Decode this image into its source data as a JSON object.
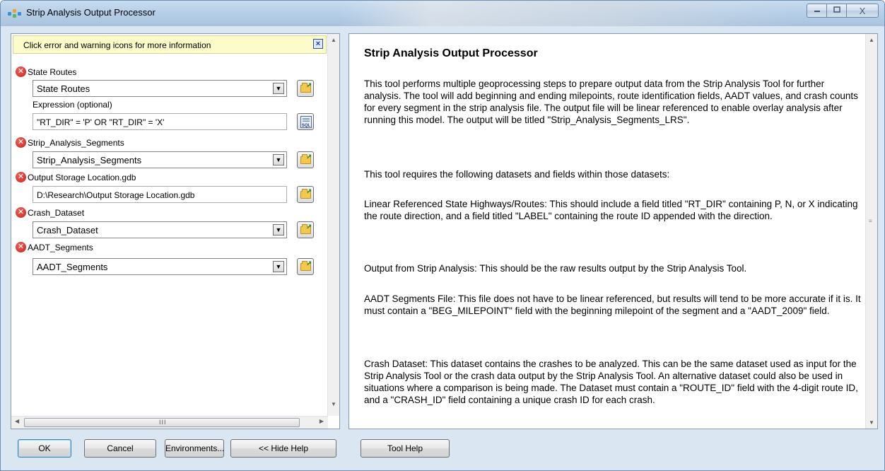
{
  "window": {
    "title": "Strip Analysis Output Processor",
    "controls": {
      "minimize": "▭",
      "maximize": "▢",
      "close": "X"
    }
  },
  "info_bar": {
    "message": "Click error and warning icons for more information",
    "close": "×"
  },
  "parameters": [
    {
      "label": "State Routes",
      "value": "State Routes",
      "control": "combo",
      "error": true
    },
    {
      "label": "Expression (optional)",
      "value": "\"RT_DIR\" = 'P' OR \"RT_DIR\" = 'X'",
      "control": "text-sql",
      "error": false
    },
    {
      "label": "Strip_Analysis_Segments",
      "value": "Strip_Analysis_Segments",
      "control": "combo",
      "error": true
    },
    {
      "label": "Output Storage Location.gdb",
      "value": "D:\\Research\\Output Storage Location.gdb",
      "control": "text",
      "error": true
    },
    {
      "label": "Crash_Dataset",
      "value": "Crash_Dataset",
      "control": "combo",
      "error": true
    },
    {
      "label": "AADT_Segments",
      "value": "AADT_Segments",
      "control": "combo",
      "error": true
    }
  ],
  "help": {
    "title": "Strip Analysis Output Processor",
    "paragraphs": [
      "This tool performs multiple geoprocessing steps to prepare output data from the Strip Analysis Tool for further analysis. The tool will add beginning and ending milepoints, route identification fields, AADT values, and crash counts for every segment in the strip analysis file. The output file will be linear referenced to enable overlay analysis after running this model. The output will be titled \"Strip_Analysis_Segments_LRS\".",
      "This tool requires the following datasets and fields within those datasets:",
      "Linear Referenced State Highways/Routes: This should include a field titled \"RT_DIR\" containing P, N, or X indicating the route direction, and a field titled \"LABEL\" containing the route ID appended with the direction.",
      "Output from Strip Analysis: This should be the raw results output by the Strip Analysis Tool.",
      "AADT Segments File: This file does not have to be linear referenced, but results will tend to be more accurate if it is. It must contain a \"BEG_MILEPOINT\" field with the beginning milepoint of the segment and a \"AADT_2009\" field.",
      "Crash Dataset: This dataset contains the crashes to be analyzed. This can be the same dataset used as input for the Strip Analysis Tool or the crash data output by the Strip Analysis Tool. An alternative dataset could also be used in situations where a comparison is being made. The Dataset must contain a \"ROUTE_ID\" field with the 4-digit route ID, and a \"CRASH_ID\" field containing a unique crash ID for each crash."
    ]
  },
  "buttons": {
    "ok": "OK",
    "cancel": "Cancel",
    "environments": "Environments...",
    "hide_help": "<< Hide Help",
    "tool_help": "Tool Help"
  },
  "scroll": {
    "grip": "III",
    "up": "▲",
    "down": "▼",
    "left": "◀",
    "right": "▶",
    "side_grip": "≡"
  },
  "icons": {
    "error": "✕",
    "dropdown": "▼",
    "folder_arrow": "↗",
    "sql": "SQL"
  },
  "colors": {
    "error_red": "#d9241c",
    "info_bar_bg": "#fdfbc9",
    "title_bar": "#b7cfe8"
  }
}
